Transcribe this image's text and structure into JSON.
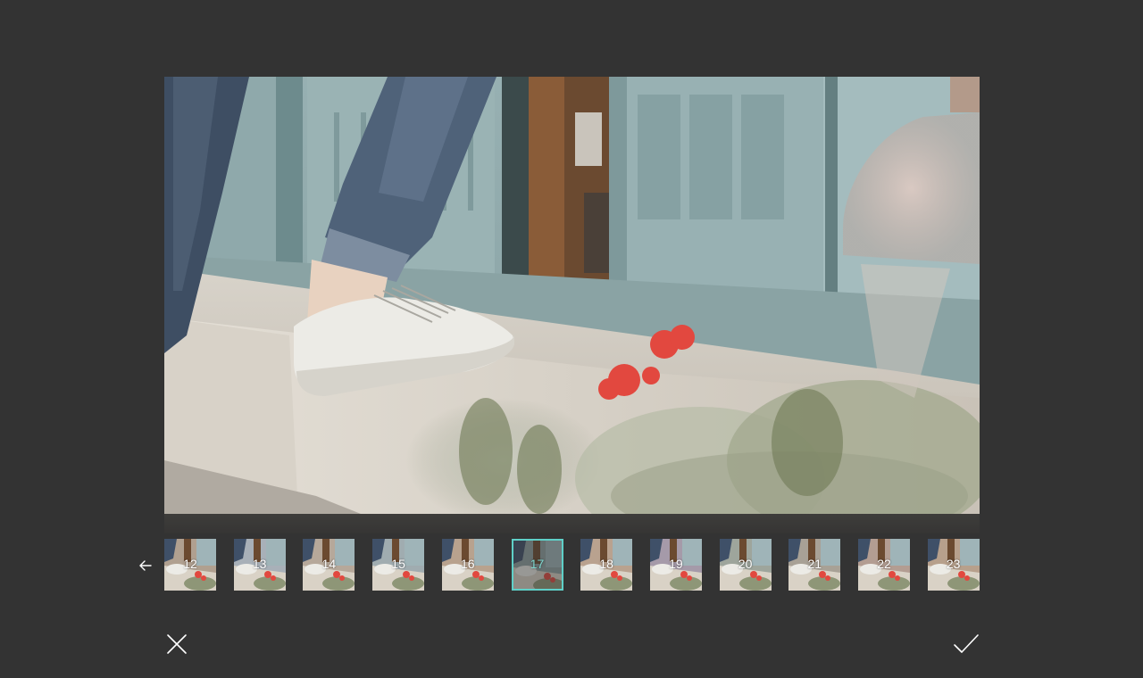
{
  "editor": {
    "accent_color": "#5fd0c8",
    "background_color": "#333333"
  },
  "preview": {
    "image": "photo of white sneaker stepping on stone ledge near blue door with red flowers"
  },
  "filters": {
    "back_icon": "arrow-left-icon",
    "selected": "17",
    "items": [
      {
        "label": "12"
      },
      {
        "label": "13"
      },
      {
        "label": "14"
      },
      {
        "label": "15"
      },
      {
        "label": "16"
      },
      {
        "label": "17"
      },
      {
        "label": "18"
      },
      {
        "label": "19"
      },
      {
        "label": "20"
      },
      {
        "label": "21"
      },
      {
        "label": "22"
      },
      {
        "label": "23"
      }
    ]
  },
  "actions": {
    "cancel_icon": "close-icon",
    "confirm_icon": "checkmark-icon"
  }
}
